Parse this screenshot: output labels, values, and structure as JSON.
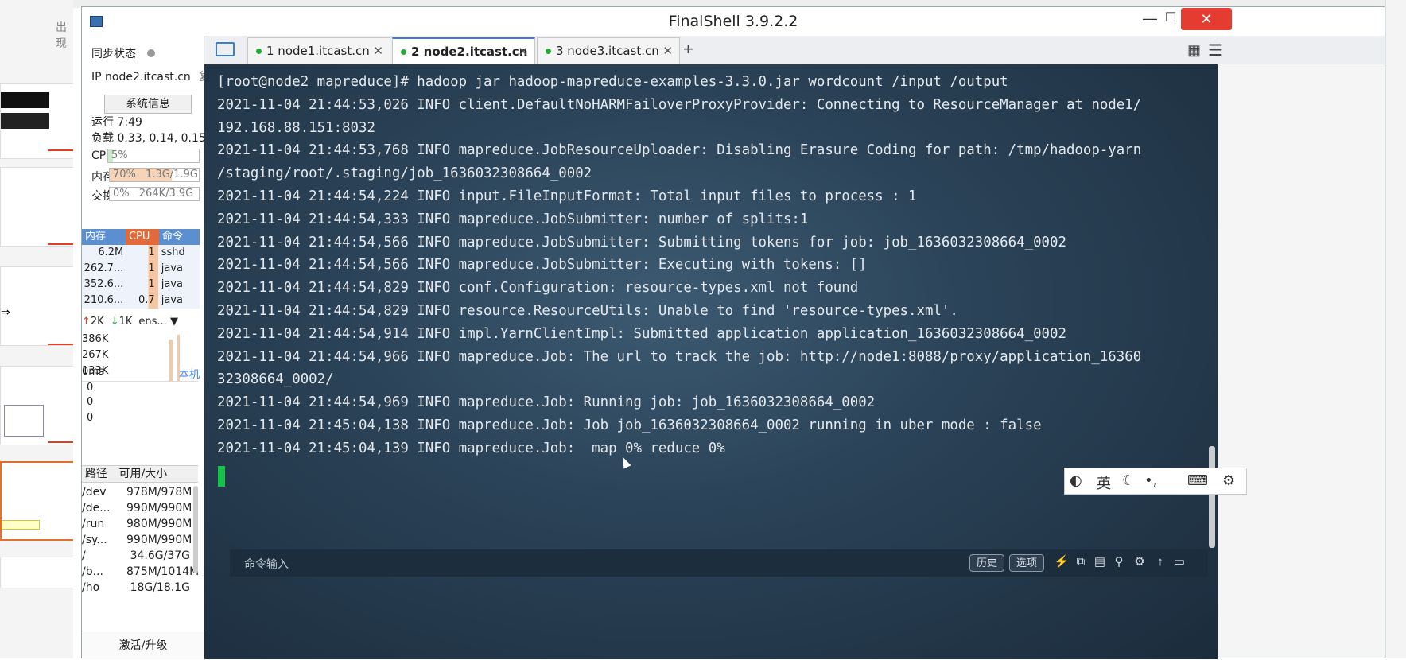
{
  "background_app": {
    "label": "出现"
  },
  "window": {
    "title": "FinalShell 3.9.2.2"
  },
  "sidebar": {
    "sync_label": "同步状态",
    "ip_label": "IP node2.itcast.cn",
    "copy_label": "复制",
    "sysinfo_button": "系统信息",
    "uptime": "运行 7:49",
    "load": "负载 0.33, 0.14, 0.15",
    "cpu": {
      "label": "CPU",
      "value": "5%",
      "fraction": 0.05
    },
    "mem": {
      "label": "内存",
      "percent": "70%",
      "value": "1.3G/1.9G",
      "fraction": 0.7
    },
    "swap": {
      "label": "交换",
      "percent": "0%",
      "value": "264K/3.9G",
      "fraction": 0.0
    },
    "proc_headers": {
      "mem": "内存",
      "cpu": "CPU",
      "cmd": "命令"
    },
    "procs": [
      {
        "mem": "6.2M",
        "cpu": "1",
        "cmd": "sshd"
      },
      {
        "mem": "262.7...",
        "cpu": "1",
        "cmd": "java"
      },
      {
        "mem": "352.6...",
        "cpu": "1",
        "cmd": "java"
      },
      {
        "mem": "210.6...",
        "cpu": "0.7",
        "cmd": "java"
      }
    ],
    "net": {
      "up": "2K",
      "down": "1K",
      "iface": "ens...",
      "ticks": [
        "386K",
        "267K",
        "133K"
      ]
    },
    "ping": {
      "ms": "0ms",
      "host": "本机",
      "vals": [
        "0",
        "0",
        "0"
      ]
    },
    "disk_headers": {
      "path": "路径",
      "size": "可用/大小"
    },
    "disks": [
      {
        "path": "/dev",
        "size": "978M/978M"
      },
      {
        "path": "/de...",
        "size": "990M/990M"
      },
      {
        "path": "/run",
        "size": "980M/990M"
      },
      {
        "path": "/sy...",
        "size": "990M/990M"
      },
      {
        "path": "/",
        "size": "34.6G/37G"
      },
      {
        "path": "/b...",
        "size": "875M/1014M"
      },
      {
        "path": "/ho",
        "size": "18G/18.1G"
      }
    ],
    "upgrade": "激活/升级"
  },
  "tabs": [
    {
      "label": "1 node1.itcast.cn"
    },
    {
      "label": "2 node2.itcast.cn"
    },
    {
      "label": "3 node3.itcast.cn"
    }
  ],
  "tab_add": "+",
  "terminal": {
    "lines": [
      "[root@node2 mapreduce]# hadoop jar hadoop-mapreduce-examples-3.3.0.jar wordcount /input /output",
      "2021-11-04 21:44:53,026 INFO client.DefaultNoHARMFailoverProxyProvider: Connecting to ResourceManager at node1/",
      "192.168.88.151:8032",
      "2021-11-04 21:44:53,768 INFO mapreduce.JobResourceUploader: Disabling Erasure Coding for path: /tmp/hadoop-yarn",
      "/staging/root/.staging/job_1636032308664_0002",
      "2021-11-04 21:44:54,224 INFO input.FileInputFormat: Total input files to process : 1",
      "2021-11-04 21:44:54,333 INFO mapreduce.JobSubmitter: number of splits:1",
      "2021-11-04 21:44:54,566 INFO mapreduce.JobSubmitter: Submitting tokens for job: job_1636032308664_0002",
      "2021-11-04 21:44:54,566 INFO mapreduce.JobSubmitter: Executing with tokens: []",
      "2021-11-04 21:44:54,829 INFO conf.Configuration: resource-types.xml not found",
      "2021-11-04 21:44:54,829 INFO resource.ResourceUtils: Unable to find 'resource-types.xml'.",
      "2021-11-04 21:44:54,914 INFO impl.YarnClientImpl: Submitted application application_1636032308664_0002",
      "2021-11-04 21:44:54,966 INFO mapreduce.Job: The url to track the job: http://node1:8088/proxy/application_16360",
      "32308664_0002/",
      "2021-11-04 21:44:54,969 INFO mapreduce.Job: Running job: job_1636032308664_0002",
      "2021-11-04 21:45:04,138 INFO mapreduce.Job: Job job_1636032308664_0002 running in uber mode : false",
      "2021-11-04 21:45:04,139 INFO mapreduce.Job:  map 0% reduce 0%"
    ]
  },
  "cmdbar": {
    "placeholder": "命令输入",
    "history": "历史",
    "options": "选项"
  },
  "ime": {
    "lang": "英"
  },
  "colors": {
    "terminal_bg": "#2b4358",
    "cursor": "#17c24a",
    "close": "#e43c30",
    "accent": "#3b78d8"
  }
}
